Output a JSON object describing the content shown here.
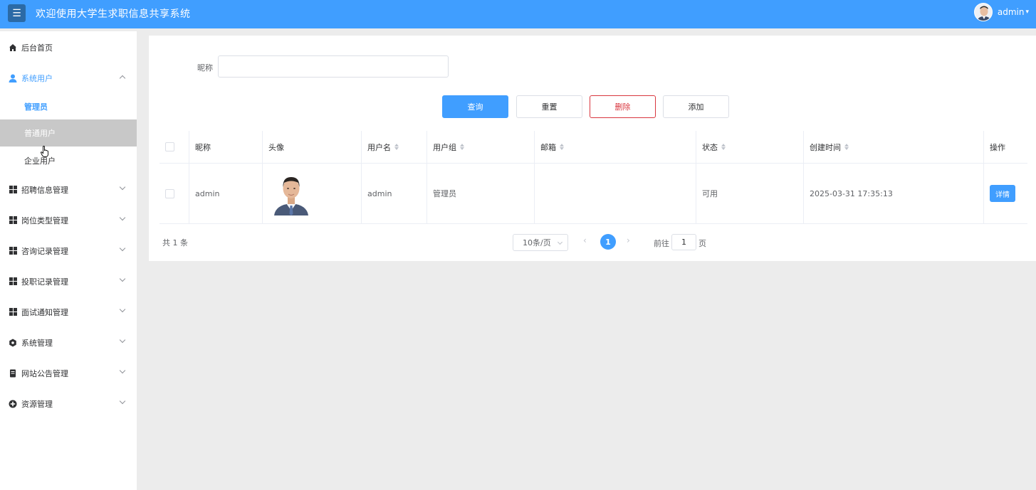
{
  "header": {
    "title": "欢迎使用大学生求职信息共享系统",
    "menu_icon": "hamburger-icon",
    "user_name": "admin"
  },
  "sidebar": {
    "home": "后台首页",
    "system_users": "系统用户",
    "sub_items": [
      "管理员",
      "普通用户",
      "企业用户"
    ],
    "items": [
      "招聘信息管理",
      "岗位类型管理",
      "咨询记录管理",
      "投职记录管理",
      "面试通知管理",
      "系统管理",
      "网站公告管理",
      "资源管理"
    ]
  },
  "search": {
    "label": "昵称",
    "value": ""
  },
  "buttons": {
    "query": "查询",
    "reset": "重置",
    "delete": "删除",
    "add": "添加"
  },
  "table": {
    "headers": [
      "昵称",
      "头像",
      "用户名",
      "用户组",
      "邮箱",
      "状态",
      "创建时间",
      "操作"
    ],
    "rows": [
      {
        "nickname": "admin",
        "username": "admin",
        "group": "管理员",
        "email": "",
        "status": "可用",
        "created": "2025-03-31 17:35:13",
        "action": "详情"
      }
    ]
  },
  "pagination": {
    "total": "共 1 条",
    "page_size": "10条/页",
    "current": "1",
    "goto_label": "前往",
    "goto_value": "1",
    "goto_suffix": "页"
  },
  "colors": {
    "primary": "#409eff",
    "danger": "#d9363e",
    "header_bg": "#409eff"
  }
}
